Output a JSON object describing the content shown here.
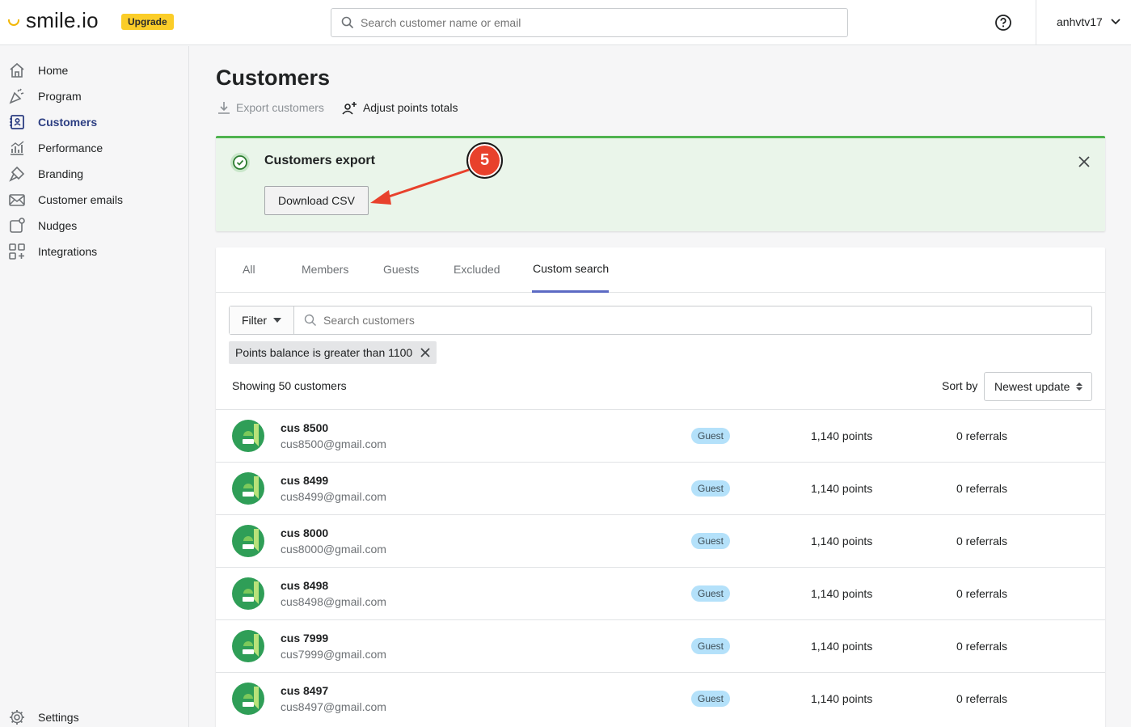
{
  "app": {
    "logo_text": "smile.io",
    "upgrade_label": "Upgrade",
    "search_placeholder": "Search customer name or email",
    "username": "anhvtv17"
  },
  "sidebar": {
    "items": [
      {
        "label": "Home",
        "icon": "home-icon"
      },
      {
        "label": "Program",
        "icon": "party-icon"
      },
      {
        "label": "Customers",
        "icon": "address-book-icon",
        "active": true
      },
      {
        "label": "Performance",
        "icon": "chart-icon"
      },
      {
        "label": "Branding",
        "icon": "paint-icon"
      },
      {
        "label": "Customer emails",
        "icon": "email-icon"
      },
      {
        "label": "Nudges",
        "icon": "nudge-icon"
      },
      {
        "label": "Integrations",
        "icon": "apps-icon"
      }
    ],
    "settings_label": "Settings"
  },
  "page": {
    "title": "Customers",
    "export_label": "Export customers",
    "adjust_label": "Adjust points totals"
  },
  "banner": {
    "title": "Customers export",
    "download_label": "Download CSV",
    "step_number": "5"
  },
  "tabs": [
    "All",
    "Members",
    "Guests",
    "Excluded",
    "Custom search"
  ],
  "active_tab": "Custom search",
  "filter": {
    "button_label": "Filter",
    "search_placeholder": "Search customers",
    "chip_label": "Points balance is greater than 1100"
  },
  "list": {
    "showing_text": "Showing 50 customers",
    "sort_label": "Sort by",
    "sort_value": "Newest update",
    "customers": [
      {
        "name": "cus 8500",
        "email": "cus8500@gmail.com",
        "status": "Guest",
        "points": "1,140 points",
        "referrals": "0 referrals"
      },
      {
        "name": "cus 8499",
        "email": "cus8499@gmail.com",
        "status": "Guest",
        "points": "1,140 points",
        "referrals": "0 referrals"
      },
      {
        "name": "cus 8000",
        "email": "cus8000@gmail.com",
        "status": "Guest",
        "points": "1,140 points",
        "referrals": "0 referrals"
      },
      {
        "name": "cus 8498",
        "email": "cus8498@gmail.com",
        "status": "Guest",
        "points": "1,140 points",
        "referrals": "0 referrals"
      },
      {
        "name": "cus 7999",
        "email": "cus7999@gmail.com",
        "status": "Guest",
        "points": "1,140 points",
        "referrals": "0 referrals"
      },
      {
        "name": "cus 8497",
        "email": "cus8497@gmail.com",
        "status": "Guest",
        "points": "1,140 points",
        "referrals": "0 referrals"
      }
    ]
  },
  "colors": {
    "accent": "#5c6ac4",
    "success_border": "#4fb34f",
    "success_bg": "#eaf5ea",
    "annotation": "#e8412c",
    "badge_guest": "#b4e1fa",
    "avatar_green": "#2f9e57"
  }
}
